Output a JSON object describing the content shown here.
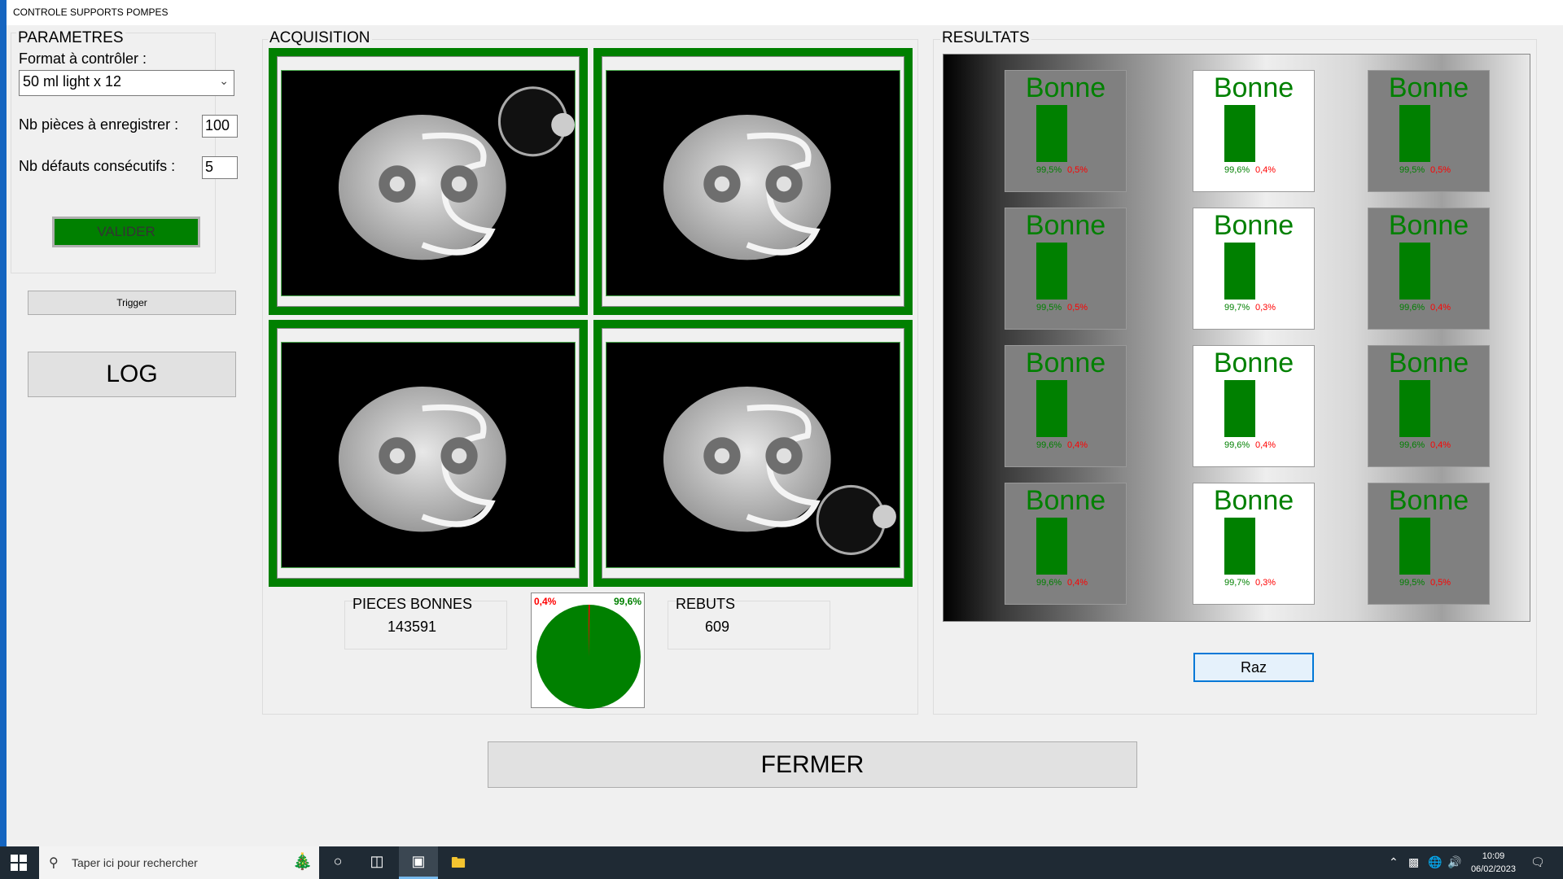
{
  "window": {
    "title": "CONTROLE SUPPORTS POMPES"
  },
  "parametres": {
    "title": "PARAMETRES",
    "format_label": "Format à contrôler :",
    "format_value": "50 ml light x 12",
    "nb_pieces_label": "Nb pièces à enregistrer :",
    "nb_pieces_value": "100",
    "nb_defauts_label": "Nb défauts consécutifs :",
    "nb_defauts_value": "5",
    "valider_label": "VALIDER"
  },
  "trigger_label": "Trigger",
  "log_label": "LOG",
  "acquisition": {
    "title": "ACQUISITION",
    "images": [
      {
        "name": "camera-1",
        "cap": "top-right"
      },
      {
        "name": "camera-2",
        "cap": "none"
      },
      {
        "name": "camera-3",
        "cap": "none"
      },
      {
        "name": "camera-4",
        "cap": "bottom-right"
      }
    ],
    "pieces_bonnes_label": "PIECES BONNES",
    "pieces_bonnes_value": "143591",
    "rebuts_label": "REBUTS",
    "rebuts_value": "609",
    "pie": {
      "bad_label": "0,4%",
      "good_label": "99,6%",
      "good_color": "#008000",
      "bad_color": "#ff0000",
      "good_fraction": 0.996
    }
  },
  "resultats": {
    "title": "RESULTATS",
    "tiles": [
      {
        "word": "Bonne",
        "good": "99,5%",
        "bad": "0,5%",
        "bg": "gray"
      },
      {
        "word": "Bonne",
        "good": "99,6%",
        "bad": "0,4%",
        "bg": "white"
      },
      {
        "word": "Bonne",
        "good": "99,5%",
        "bad": "0,5%",
        "bg": "gray"
      },
      {
        "word": "Bonne",
        "good": "99,5%",
        "bad": "0,5%",
        "bg": "gray"
      },
      {
        "word": "Bonne",
        "good": "99,7%",
        "bad": "0,3%",
        "bg": "white"
      },
      {
        "word": "Bonne",
        "good": "99,6%",
        "bad": "0,4%",
        "bg": "gray"
      },
      {
        "word": "Bonne",
        "good": "99,6%",
        "bad": "0,4%",
        "bg": "gray"
      },
      {
        "word": "Bonne",
        "good": "99,6%",
        "bad": "0,4%",
        "bg": "white"
      },
      {
        "word": "Bonne",
        "good": "99,6%",
        "bad": "0,4%",
        "bg": "gray"
      },
      {
        "word": "Bonne",
        "good": "99,6%",
        "bad": "0,4%",
        "bg": "gray"
      },
      {
        "word": "Bonne",
        "good": "99,7%",
        "bad": "0,3%",
        "bg": "white"
      },
      {
        "word": "Bonne",
        "good": "99,5%",
        "bad": "0,5%",
        "bg": "gray"
      }
    ],
    "raz_label": "Raz"
  },
  "fermer_label": "FERMER",
  "taskbar": {
    "search_placeholder": "Taper ici pour rechercher",
    "time": "10:09",
    "date": "06/02/2023",
    "icons": [
      "windows-start-icon",
      "search-icon",
      "cortana-icon",
      "task-view-icon",
      "app-window-icon",
      "file-explorer-icon",
      "tray-chevron-icon",
      "meet-icon",
      "network-icon",
      "volume-icon",
      "notification-icon"
    ]
  }
}
